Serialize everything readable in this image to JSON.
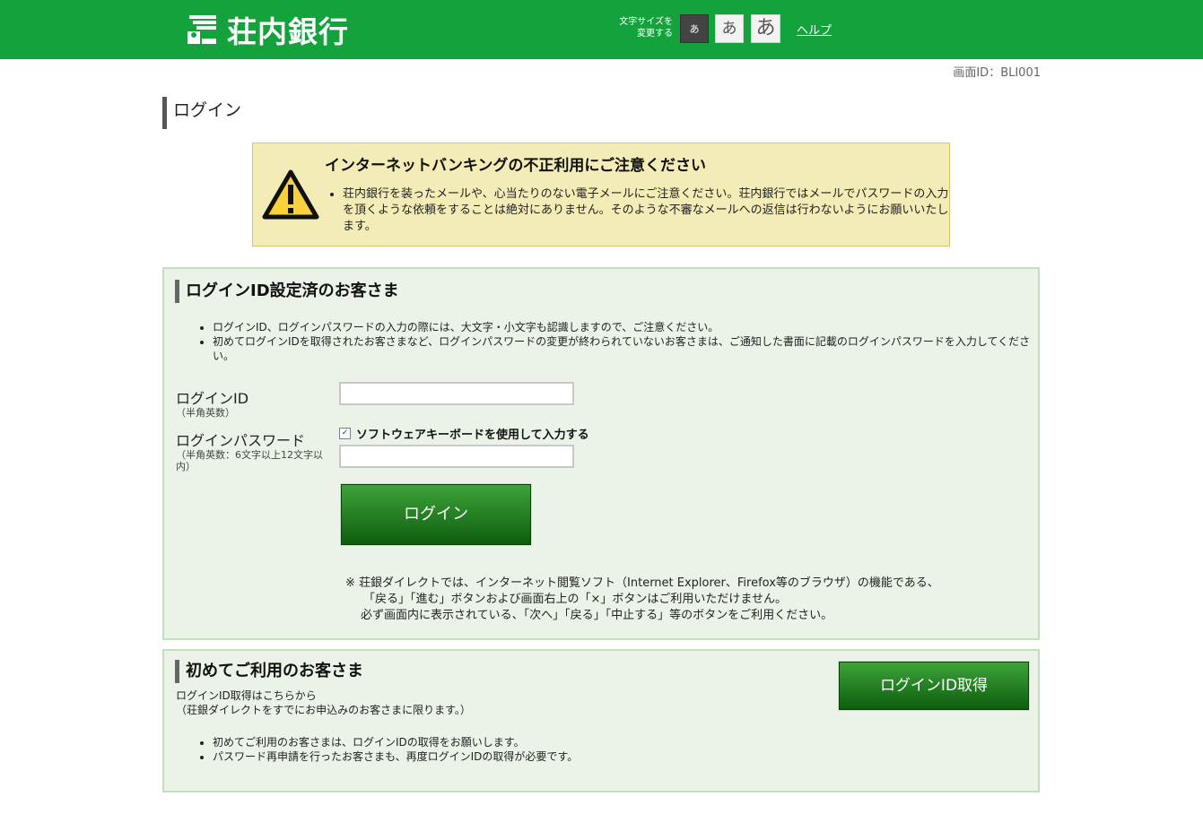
{
  "header": {
    "logo_text": "荘内銀行",
    "font_size_label_1": "文字サイズを",
    "font_size_label_2": "変更する",
    "font_small": "あ",
    "font_medium": "あ",
    "font_large": "あ",
    "help_label": "ヘルプ",
    "brand_color": "#14a23d"
  },
  "screen_id": "画面ID：BLI001",
  "page_title": "ログイン",
  "warning": {
    "title": "インターネットバンキングの不正利用にご注意ください",
    "text": "荘内銀行を装ったメールや、心当たりのない電子メールにご注意ください。荘内銀行ではメールでパスワードの入力を頂くような依頼をすることは絶対にありません。そのような不審なメールへの返信は行わないようにお願いいたします。"
  },
  "login_panel": {
    "heading": "ログインID設定済のお客さま",
    "bullets": [
      "ログインID、ログインパスワードの入力の際には、大文字・小文字も認識しますので、ご注意ください。",
      "初めてログインIDを取得されたお客さまなど、ログインパスワードの変更が終わられていないお客さまは、ご通知した書面に記載のログインパスワードを入力してください。"
    ],
    "login_id_label": "ログインID",
    "login_id_note": "（半角英数）",
    "login_id_value": "",
    "password_label": "ログインパスワード",
    "password_note": "（半角英数：6文字以上12文字以内）",
    "password_value": "",
    "software_keyboard_label": "ソフトウェアキーボードを使用して入力する",
    "software_keyboard_checked": true,
    "login_button": "ログイン",
    "notes": [
      "※ 荘銀ダイレクトでは、インターネット閲覧ソフト（Internet Explorer、Firefox等のブラウザ）の機能である、",
      "「戻る」「進む」ボタンおよび画面右上の「×」ボタンはご利用いただけません。",
      "必ず画面内に表示されている、「次へ」「戻る」「中止する」等のボタンをご利用ください。"
    ]
  },
  "first_panel": {
    "heading": "初めてご利用のお客さま",
    "sub1": "ログインID取得はこちらから",
    "sub2": "（荘銀ダイレクトをすでにお申込みのお客さまに限ります。）",
    "bullets": [
      "初めてご利用のお客さまは、ログインIDの取得をお願いします。",
      "パスワード再申請を行ったお客さまも、再度ログインIDの取得が必要です。"
    ],
    "get_id_button": "ログインID取得"
  }
}
